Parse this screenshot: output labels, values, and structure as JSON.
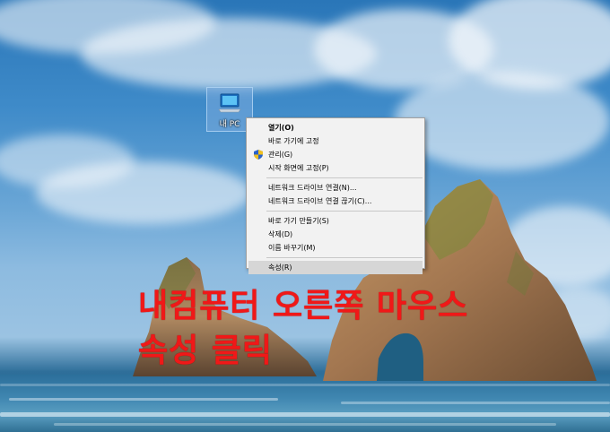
{
  "desktop": {
    "icon": {
      "label": "내 PC",
      "icon_name": "computer-icon"
    }
  },
  "context_menu": {
    "items": [
      {
        "label": "열기(O)",
        "bold": true
      },
      {
        "label": "바로 가기에 고정"
      },
      {
        "label": "관리(G)",
        "icon": "uac-shield-icon"
      },
      {
        "label": "시작 화면에 고정(P)"
      },
      {
        "separator": true
      },
      {
        "label": "네트워크 드라이브 연결(N)..."
      },
      {
        "label": "네트워크 드라이브 연결 끊기(C)..."
      },
      {
        "separator": true
      },
      {
        "label": "바로 가기 만들기(S)"
      },
      {
        "label": "삭제(D)"
      },
      {
        "label": "이름 바꾸기(M)"
      },
      {
        "separator": true
      },
      {
        "label": "속성(R)",
        "highlighted": true
      }
    ]
  },
  "annotation": {
    "line1": "내컴퓨터 오른쪽 마우스",
    "line2": "속성 클릭",
    "color": "#f01818"
  }
}
